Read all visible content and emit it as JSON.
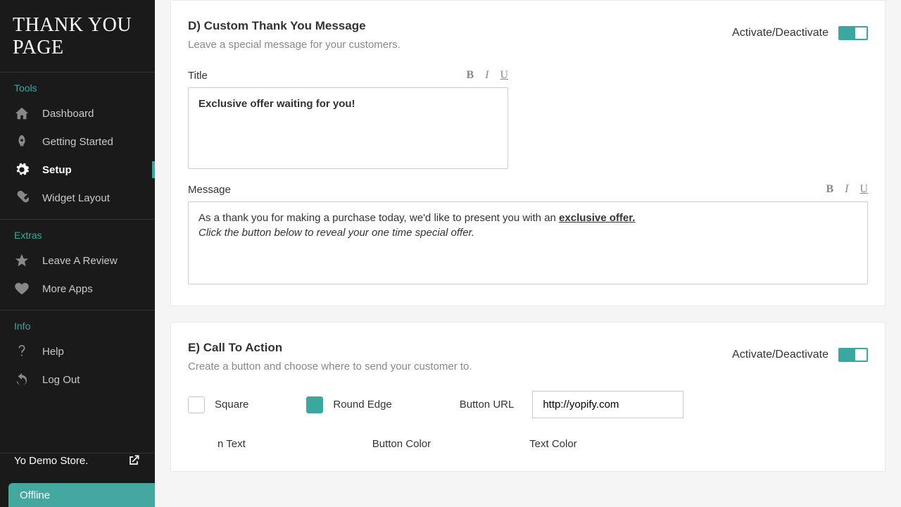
{
  "logo": "THANK YOU PAGE",
  "sections": {
    "tools": {
      "title": "Tools",
      "items": [
        "Dashboard",
        "Getting Started",
        "Setup",
        "Widget Layout"
      ]
    },
    "extras": {
      "title": "Extras",
      "items": [
        "Leave A Review",
        "More Apps"
      ]
    },
    "info": {
      "title": "Info",
      "items": [
        "Help",
        "Log Out"
      ]
    }
  },
  "store_name": "Yo Demo Store.",
  "offline": "Offline",
  "cardD": {
    "title": "D) Custom Thank You Message",
    "sub": "Leave a special message for your customers.",
    "activate": "Activate/Deactivate",
    "title_label": "Title",
    "title_value": "Exclusive offer waiting for you!",
    "msg_label": "Message",
    "msg_plain": "As a thank you for making a purchase today, we'd like to present you with an ",
    "msg_ul": "exclusive offer.",
    "msg_line2": "Click the button below to reveal your one time special offer."
  },
  "cardE": {
    "title": "E) Call To Action",
    "sub": "Create a button and choose where to send your customer to.",
    "activate": "Activate/Deactivate",
    "square": "Square",
    "round": "Round Edge",
    "url_label": "Button URL",
    "url_value": "http://yopify.com",
    "btn_text": "n Text",
    "btn_color": "Button Color",
    "txt_color": "Text Color"
  }
}
